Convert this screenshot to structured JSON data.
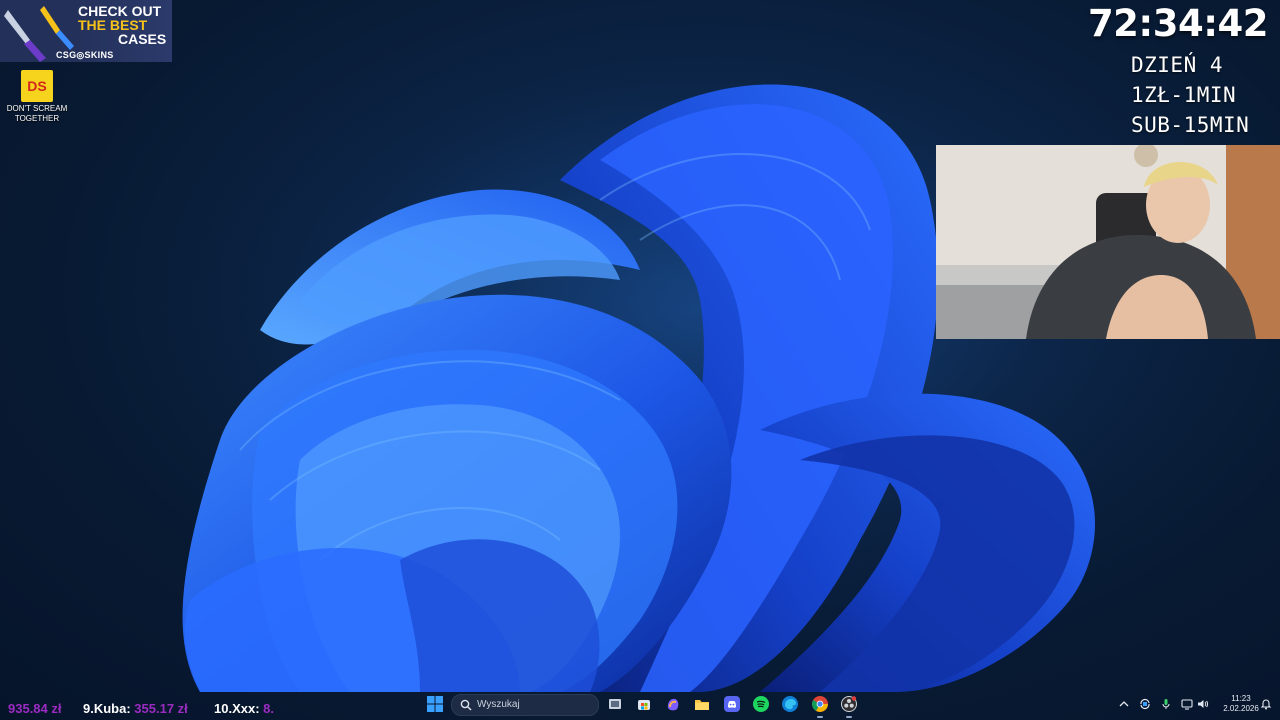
{
  "ad": {
    "line1": "CHECK OUT",
    "line2": "THE BEST",
    "line3": "CASES",
    "brand": "CSG◎SKINS"
  },
  "desktop": {
    "icons": [
      {
        "label_line1": "DON'T SCREAM",
        "label_line2": "TOGETHER",
        "badge": "DS"
      }
    ]
  },
  "overlay": {
    "timer": "72:34:42",
    "day": "DZIEŃ 4",
    "rate": "1ZŁ-1MIN",
    "sub": "SUB-15MIN"
  },
  "leaderboard": [
    {
      "rank_name": "",
      "amount": "935.84 zł"
    },
    {
      "rank_name": "9.Kuba:",
      "amount": "355.17 zł"
    },
    {
      "rank_name": "10.Xxx:",
      "amount": "8."
    }
  ],
  "taskbar": {
    "search_placeholder": "Wyszukaj",
    "apps": [
      "start",
      "task-view",
      "store",
      "copilot",
      "file-explorer",
      "discord",
      "spotify",
      "edge",
      "chrome",
      "obs"
    ],
    "clock_time": "11:23",
    "clock_date": "2.02.2026"
  },
  "colors": {
    "ad_yellow": "#f6c21a",
    "amount_purple": "#9b2cc2",
    "wallpaper_blue": "#1e5ef0"
  }
}
